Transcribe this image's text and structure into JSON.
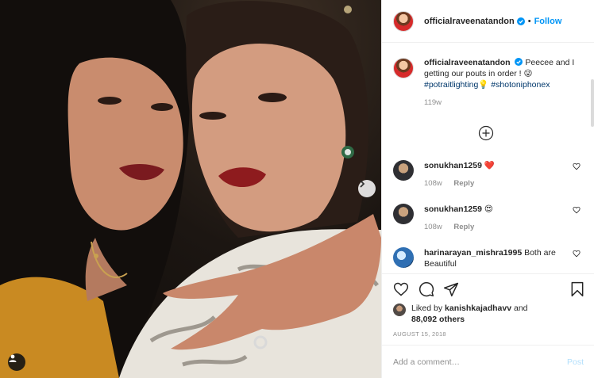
{
  "post": {
    "photo": {
      "alt_icon": "selfie-photo"
    },
    "header": {
      "username": "officialraveenatandon",
      "dot": "•",
      "follow_label": "Follow"
    },
    "caption": {
      "username": "officialraveenatandon",
      "text": "Peecee and I getting our pouts in order ! 😜",
      "hashtags": [
        "#potraitlighting💡",
        "#shotoniphonex"
      ],
      "time": "119w"
    },
    "comments": [
      {
        "username": "sonukhan1259",
        "text": "❤️",
        "time": "108w",
        "reply_label": "Reply"
      },
      {
        "username": "sonukhan1259",
        "text": "😍",
        "time": "108w",
        "reply_label": "Reply"
      },
      {
        "username": "harinarayan_mishra1995",
        "text": "Both are Beautiful"
      }
    ],
    "likes": {
      "prefix": "Liked by",
      "user": "kanishkajadhavv",
      "and": "and",
      "count": "88,092 others"
    },
    "date": "AUGUST 15, 2018",
    "add_comment": {
      "placeholder": "Add a comment…",
      "post_label": "Post"
    }
  },
  "colors": {
    "accent": "#0095f6",
    "link": "#00376b",
    "muted": "#8e8e8e",
    "post_disabled": "#b2dffc",
    "heart": "#ed4956"
  }
}
